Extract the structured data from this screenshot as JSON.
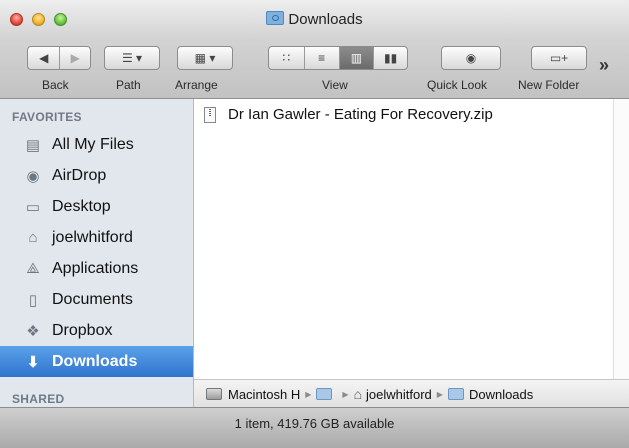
{
  "window": {
    "title": "Downloads"
  },
  "toolbar": {
    "back_label": "Back",
    "path_label": "Path",
    "arrange_label": "Arrange",
    "view_label": "View",
    "quicklook_label": "Quick Look",
    "newfolder_label": "New Folder",
    "overflow_glyph": "»",
    "active_view": "columns"
  },
  "sidebar": {
    "favorites_header": "FAVORITES",
    "shared_header": "SHARED",
    "items": [
      {
        "label": "All My Files",
        "icon": "all-files-icon",
        "glyph": "▤"
      },
      {
        "label": "AirDrop",
        "icon": "airdrop-icon",
        "glyph": "◉"
      },
      {
        "label": "Desktop",
        "icon": "desktop-icon",
        "glyph": "▭"
      },
      {
        "label": "joelwhitford",
        "icon": "home-icon",
        "glyph": "⌂"
      },
      {
        "label": "Applications",
        "icon": "applications-icon",
        "glyph": "⟁"
      },
      {
        "label": "Documents",
        "icon": "documents-icon",
        "glyph": "▯"
      },
      {
        "label": "Dropbox",
        "icon": "dropbox-icon",
        "glyph": "❖"
      },
      {
        "label": "Downloads",
        "icon": "downloads-icon",
        "glyph": "⬇",
        "selected": true
      }
    ]
  },
  "files": [
    {
      "name": "Dr Ian Gawler - Eating For Recovery.zip",
      "icon": "zip-file-icon"
    }
  ],
  "pathbar": {
    "items": [
      "Macintosh H",
      "joelwhitford",
      "Downloads"
    ]
  },
  "status": {
    "text": "1 item, 419.76 GB available"
  },
  "colors": {
    "selection": "#3b82d8",
    "sidebar_bg": "#e2e7ed"
  }
}
